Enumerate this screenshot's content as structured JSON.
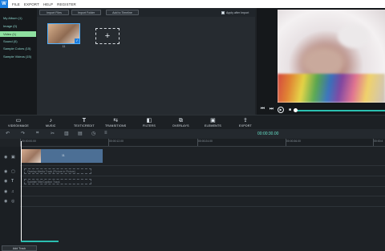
{
  "menubar": {
    "logo": "W",
    "items": [
      "FILE",
      "EXPORT",
      "HELP",
      "REGISTER"
    ]
  },
  "library": {
    "items": [
      {
        "label": "My Album (1)",
        "active": false
      },
      {
        "label": "Image (0)",
        "active": false
      },
      {
        "label": "Video (1)",
        "active": true
      },
      {
        "label": "Sound (0)",
        "active": false
      },
      {
        "label": "Sample Colors (15)",
        "active": false
      },
      {
        "label": "Sample Videos (15)",
        "active": false
      }
    ]
  },
  "media": {
    "import_files": "Import Files",
    "import_folder": "Import Folder",
    "add_to_timeline": "Add to Timeline",
    "apply_after_import": "Apply after Import",
    "thumb_label": "11",
    "add_symbol": "+"
  },
  "player": {
    "prev": "⏮",
    "next": "⏭",
    "play": "▶",
    "stop": "■"
  },
  "toolbar": {
    "items": [
      "VIDEO/IMAGE",
      "MUSIC",
      "TEXT/CREDIT",
      "TRANSITIONS",
      "FILTERS",
      "OVERLAYS",
      "ELEMENTS",
      "EXPORT"
    ]
  },
  "timeline": {
    "time_display": "00:00:30.00",
    "ruler": [
      "00:00:00.00",
      "00:00:12.00",
      "00:00:24.00",
      "00:00:36.00",
      "00:00:4"
    ],
    "clip_label": "11",
    "overlay_track": "Overlay Media Track (Picture in Picture)",
    "text_track": "Subtitle/Title/Caption Track",
    "add_track": "Add Track"
  },
  "colors": {
    "accent": "#2bbfb0",
    "brand": "#1d7fe0",
    "active_item": "#8fe0a0"
  }
}
